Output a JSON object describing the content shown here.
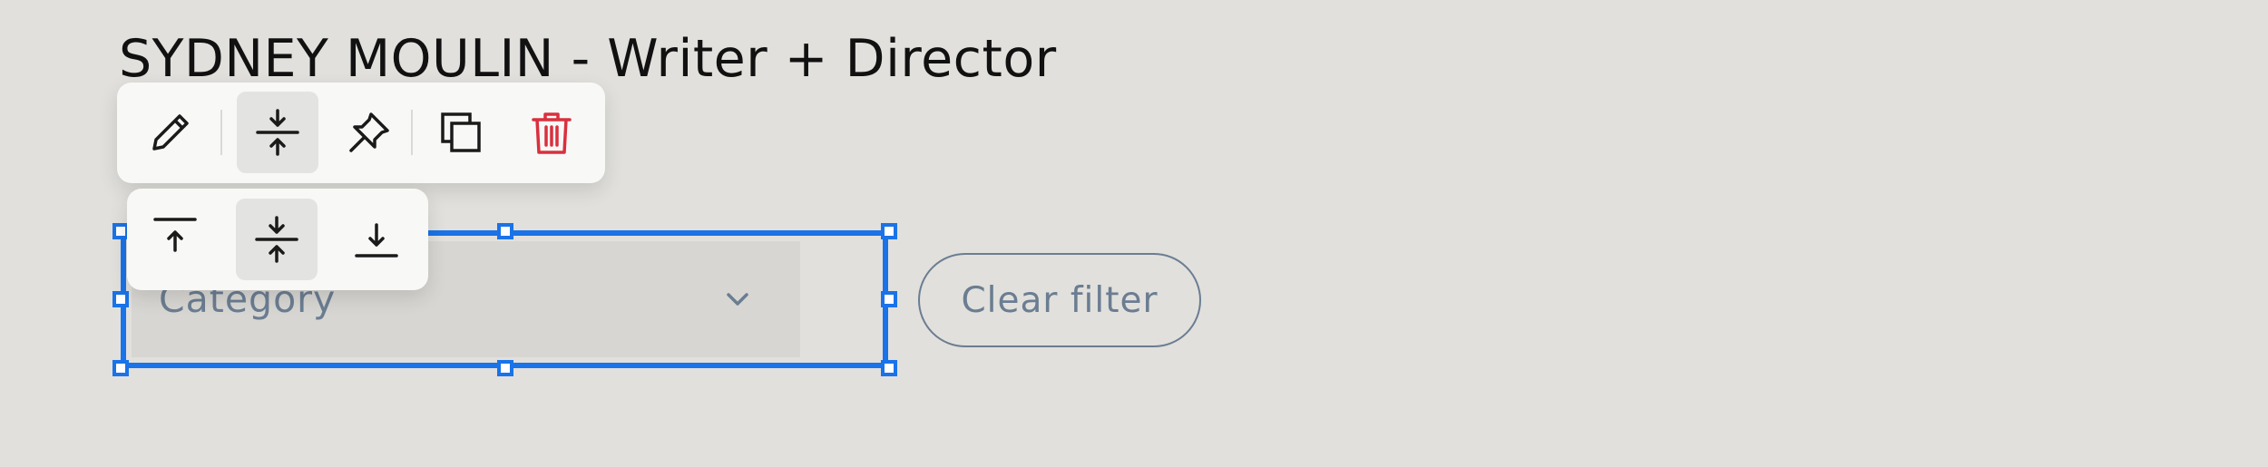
{
  "page": {
    "title": "SYDNEY MOULIN - Writer + Director"
  },
  "toolbar": {
    "buttons": [
      {
        "icon": "pencil-icon",
        "name": "edit-button"
      },
      {
        "icon": "align-vertical-center-icon",
        "name": "vertical-align-button",
        "active": true
      },
      {
        "icon": "pin-icon",
        "name": "pin-button"
      },
      {
        "icon": "duplicate-icon",
        "name": "duplicate-button"
      },
      {
        "icon": "trash-icon",
        "name": "delete-button",
        "color": "#d9303e"
      }
    ]
  },
  "align_menu": {
    "options": [
      {
        "icon": "align-top-icon",
        "name": "align-top-option"
      },
      {
        "icon": "align-middle-icon",
        "name": "align-middle-option",
        "active": true
      },
      {
        "icon": "align-bottom-icon",
        "name": "align-bottom-option"
      }
    ]
  },
  "filter": {
    "dropdown_placeholder": "Category",
    "clear_label": "Clear filter"
  },
  "colors": {
    "background": "#e1e0dc",
    "selection": "#1a73e8",
    "muted_text": "#6b7d92",
    "danger": "#d9303e"
  }
}
